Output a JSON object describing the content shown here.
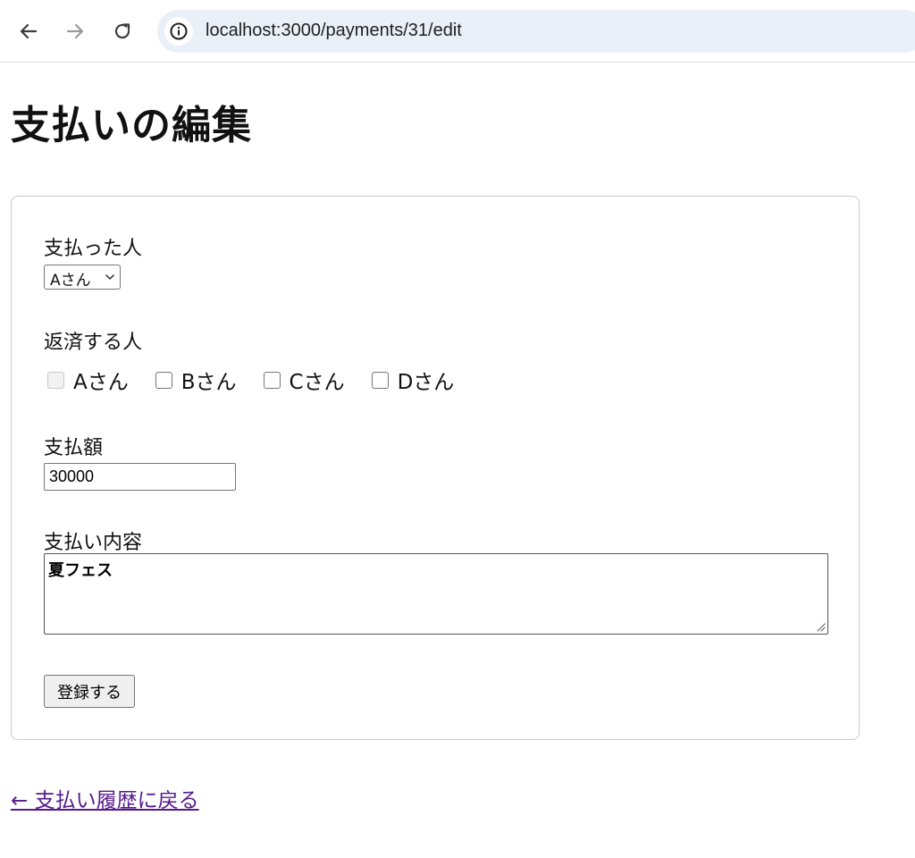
{
  "browser": {
    "url": "localhost:3000/payments/31/edit",
    "icons": {
      "back": "arrow-left-icon",
      "forward": "arrow-right-icon",
      "reload": "reload-icon",
      "site_info": "info-icon"
    }
  },
  "page": {
    "title": "支払いの編集"
  },
  "form": {
    "payer": {
      "label": "支払った人",
      "selected": "Aさん"
    },
    "repayers": {
      "label": "返済する人",
      "options": [
        {
          "label": "Aさん",
          "checked": false,
          "disabled": true
        },
        {
          "label": "Bさん",
          "checked": false,
          "disabled": false
        },
        {
          "label": "Cさん",
          "checked": false,
          "disabled": false
        },
        {
          "label": "Dさん",
          "checked": false,
          "disabled": false
        }
      ]
    },
    "amount": {
      "label": "支払額",
      "value": "30000"
    },
    "description": {
      "label": "支払い内容",
      "value": "夏フェス"
    },
    "submit_label": "登録する"
  },
  "back_link": {
    "label": "← 支払い履歴に戻る"
  },
  "colors": {
    "omnibox_bg": "#eaf0f8",
    "link_visited": "#551a8b",
    "button_bg": "#efefef",
    "card_border": "#cccccc"
  }
}
